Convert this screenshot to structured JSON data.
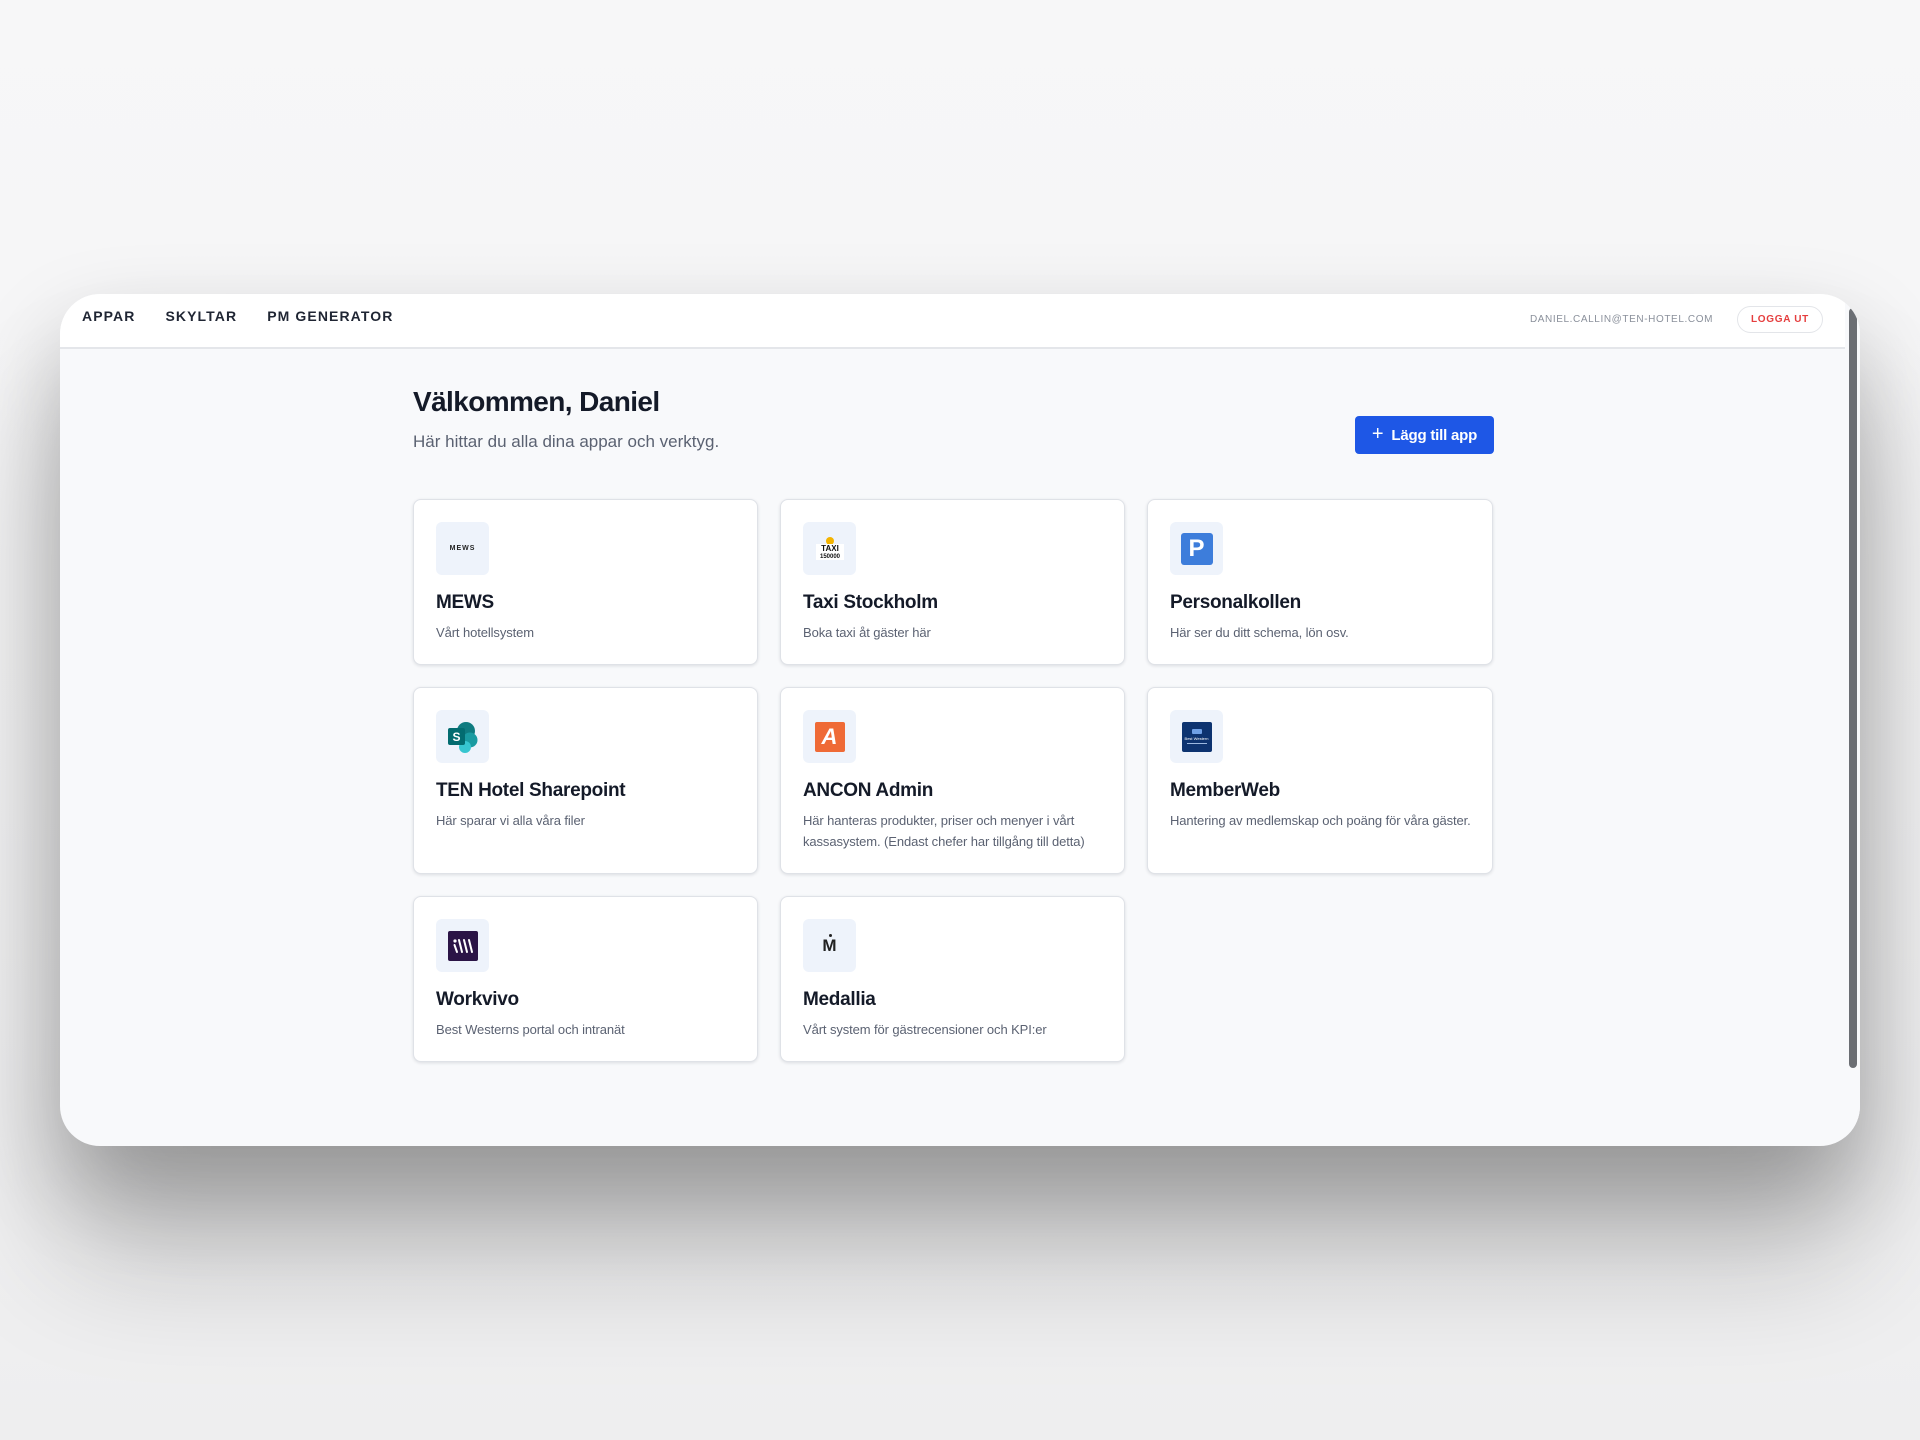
{
  "nav": {
    "items": [
      {
        "label": "APPAR"
      },
      {
        "label": "SKYLTAR"
      },
      {
        "label": "PM GENERATOR"
      }
    ]
  },
  "user": {
    "email": "DANIEL.CALLIN@TEN-HOTEL.COM",
    "logout_label": "LOGGA UT"
  },
  "header": {
    "title": "Välkommen, Daniel",
    "subtitle": "Här hittar du alla dina appar och verktyg.",
    "add_button_label": "Lägg till app"
  },
  "apps": [
    {
      "name": "MEWS",
      "description": "Vårt hotellsystem",
      "icon": "mews-logo-icon",
      "logo_text": "MEWS"
    },
    {
      "name": "Taxi Stockholm",
      "description": "Boka taxi åt gäster här",
      "icon": "taxi-stockholm-logo-icon",
      "logo_text": "TAXI 150000"
    },
    {
      "name": "Personalkollen",
      "description": "Här ser du ditt schema, lön osv.",
      "icon": "personalkollen-logo-icon",
      "logo_text": "P"
    },
    {
      "name": "TEN Hotel Sharepoint",
      "description": "Här sparar vi alla våra filer",
      "icon": "sharepoint-logo-icon",
      "logo_text": "S"
    },
    {
      "name": "ANCON Admin",
      "description": "Här hanteras produkter, priser och menyer i vårt kassasystem. (Endast chefer har tillgång till detta)",
      "icon": "ancon-logo-icon",
      "logo_text": "A"
    },
    {
      "name": "MemberWeb",
      "description": "Hantering av medlemskap och poäng för våra gäster.",
      "icon": "memberweb-logo-icon",
      "logo_text": "Best Western"
    },
    {
      "name": "Workvivo",
      "description": "Best Westerns portal och intranät",
      "icon": "workvivo-logo-icon",
      "logo_text": "W"
    },
    {
      "name": "Medallia",
      "description": "Vårt system för gästrecensioner och KPI:er",
      "icon": "medallia-logo-icon",
      "logo_text": "M"
    }
  ],
  "colors": {
    "accent": "#1e57e6",
    "logout": "#e53e3e",
    "sharepoint": "#0f7b80",
    "ancon": "#ef6a36",
    "personalkollen": "#3d7ddb",
    "memberweb": "#0d3370",
    "workvivo": "#2b1446"
  }
}
